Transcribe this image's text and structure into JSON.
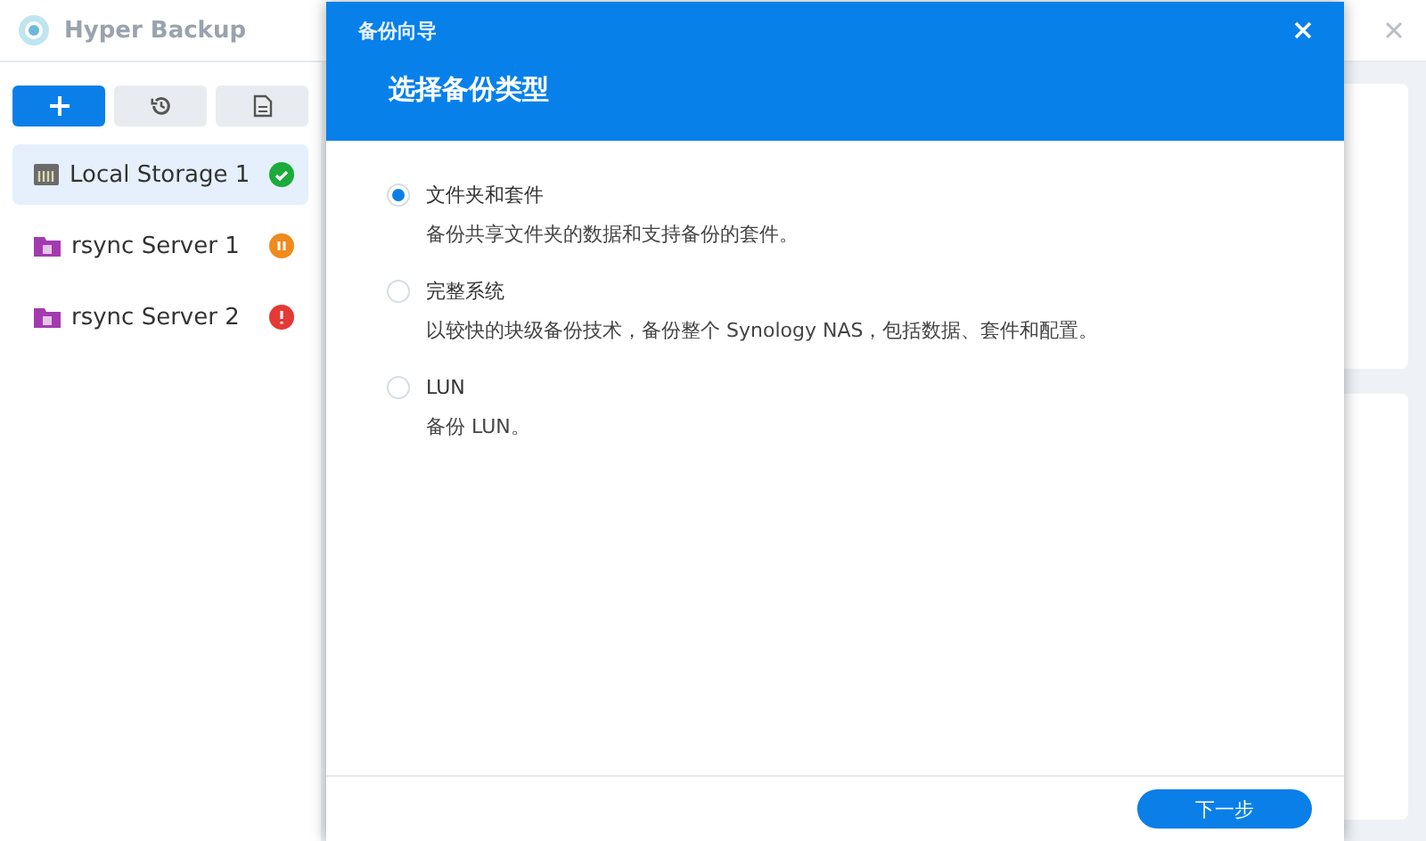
{
  "app": {
    "title": "Hyper Backup"
  },
  "toolbar": [
    {
      "kind": "add",
      "primary": true
    },
    {
      "kind": "restore",
      "primary": false
    },
    {
      "kind": "log",
      "primary": false
    }
  ],
  "tasks": [
    {
      "name": "Local Storage 1",
      "kind": "local",
      "selected": true,
      "status": {
        "kind": "ok",
        "color": "#1aab3a"
      }
    },
    {
      "name": "rsync Server 1",
      "kind": "rsync",
      "selected": false,
      "status": {
        "kind": "paused",
        "color": "#f08a1c"
      }
    },
    {
      "name": "rsync Server 2",
      "kind": "rsync",
      "selected": false,
      "status": {
        "kind": "error",
        "color": "#e53935"
      }
    }
  ],
  "dialog": {
    "title": "备份向导",
    "heading": "选择备份类型",
    "options": [
      {
        "label": "文件夹和套件",
        "description": "备份共享文件夹的数据和支持备份的套件。",
        "selected": true
      },
      {
        "label": "完整系统",
        "description": "以较快的块级备份技术，备份整个 Synology NAS，包括数据、套件和配置。",
        "selected": false
      },
      {
        "label": "LUN",
        "description": "备份 LUN。",
        "selected": false
      }
    ],
    "next_button": "下一步"
  }
}
